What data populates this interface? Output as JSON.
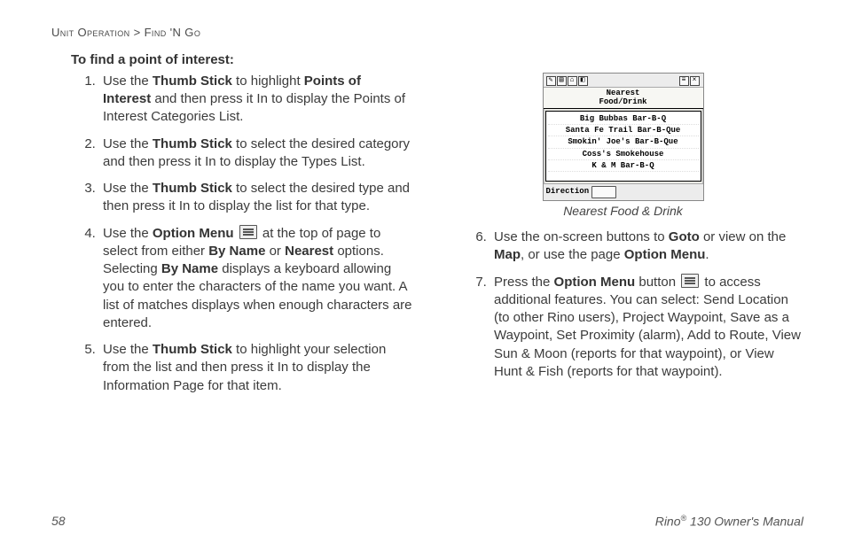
{
  "breadcrumb": {
    "a": "Unit Operation",
    "sep": " > ",
    "b": "Find 'N Go"
  },
  "heading": "To find a point of interest:",
  "steps_left": [
    {
      "html": "Use the <span class='b'>Thumb Stick</span> to highlight <span class='b'>Points of Interest</span> and then press it In to display the Points of Interest Categories List."
    },
    {
      "html": "Use the <span class='b'>Thumb Stick</span> to select the desired category and then press it In to display the Types List."
    },
    {
      "html": "Use the <span class='b'>Thumb Stick</span> to select the desired type and then press it In to display the list for that type."
    },
    {
      "html": "Use the <span class='b'>Option Menu</span> <span class='menu-icon' data-name='option-menu-icon' data-interactable='false'></span> at the top of page to select from either <span class='b'>By Name</span> or <span class='b'>Nearest</span> options. Selecting <span class='b'>By Name</span> displays a keyboard allowing you to enter the characters of the name you want. A list of matches displays when enough characters are entered."
    },
    {
      "html": "Use the <span class='b'>Thumb Stick</span> to highlight your selection from the list and then press it In to display the Information Page for that item."
    }
  ],
  "steps_right": [
    {
      "html": "Use the on-screen buttons to <span class='b'>Goto</span> or view on the <span class='b'>Map</span>, or use the page <span class='b'>Option Menu</span>."
    },
    {
      "html": "Press the <span class='b'>Option Menu</span> button <span class='menu-icon' data-name='option-menu-icon' data-interactable='false'></span> to access additional features. You can select: Send Location (to other Rino users), Project Waypoint, Save as a Waypoint, Set Proximity (alarm), Add to Route, View Sun & Moon (reports for that waypoint), or View Hunt & Fish (reports for that waypoint)."
    }
  ],
  "screenshot": {
    "title_line1": "Nearest",
    "title_line2": "Food/Drink",
    "rows": [
      "Big Bubbas Bar-B-Q",
      "Santa Fe Trail Bar-B-Que",
      "Smokin' Joe's Bar-B-Que",
      "Coss's Smokehouse",
      "K & M Bar-B-Q"
    ],
    "footer_label": "Direction",
    "caption": "Nearest Food & Drink"
  },
  "footer": {
    "page_no": "58",
    "doc_title_pre": "Rino",
    "doc_title_sup": "®",
    "doc_title_post": " 130 Owner's Manual"
  }
}
